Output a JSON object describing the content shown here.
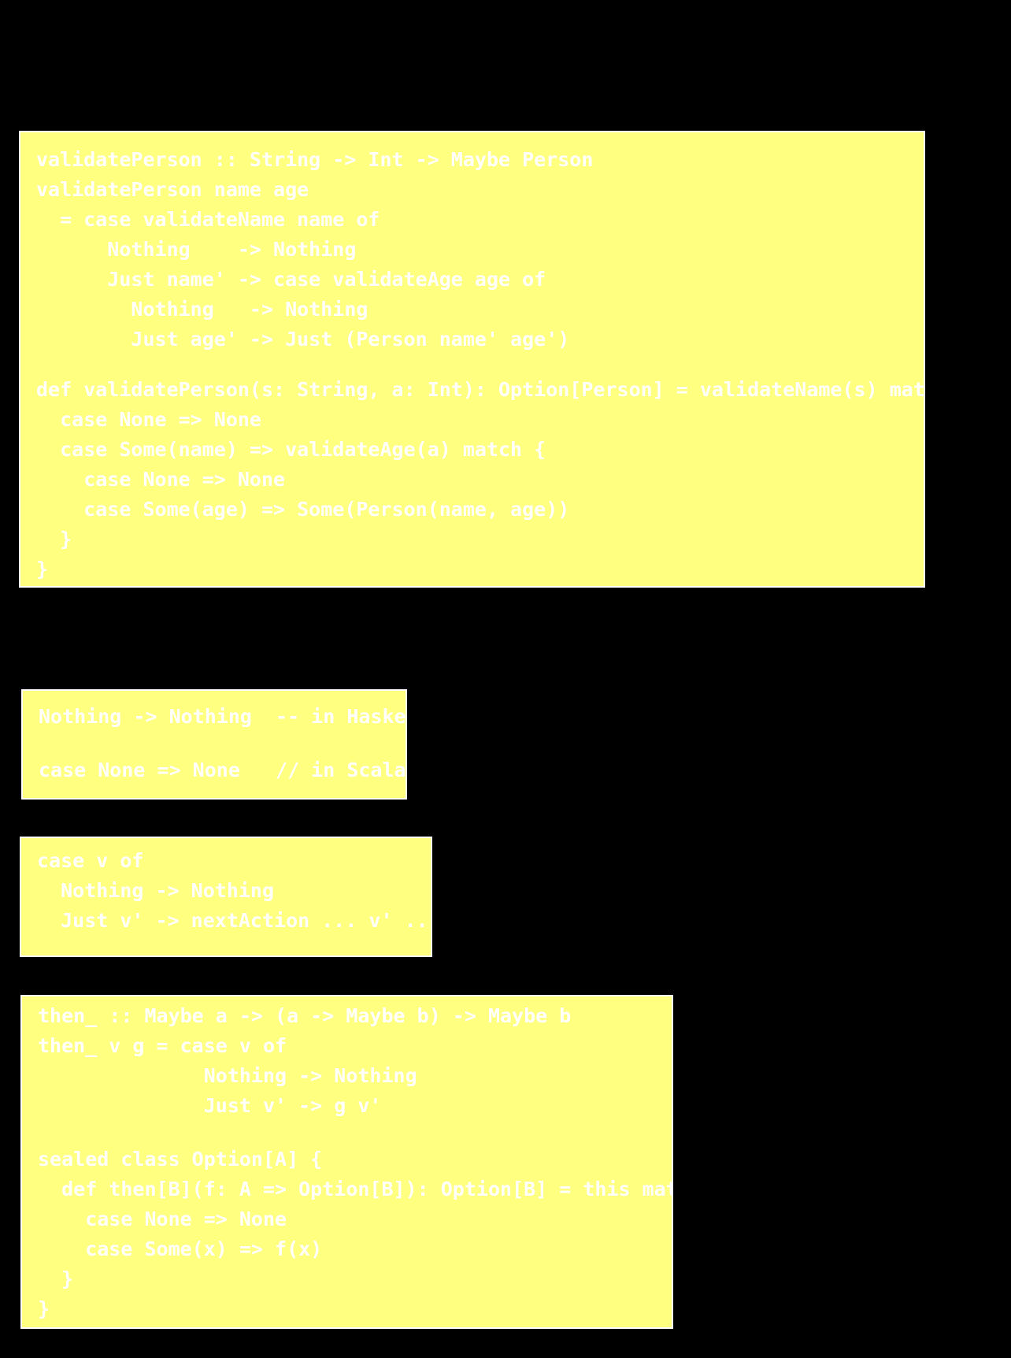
{
  "colors": {
    "background": "#000000",
    "code_box_fill": "#ffff80",
    "code_box_border": "#ffffff",
    "code_text": "#ffffff"
  },
  "blocks": {
    "validate": {
      "haskell": [
        "validatePerson :: String -> Int -> Maybe Person",
        "validatePerson name age",
        "  = case validateName name of",
        "      Nothing    -> Nothing",
        "      Just name' -> case validateAge age of",
        "        Nothing   -> Nothing",
        "        Just age' -> Just (Person name' age')"
      ],
      "scala": [
        "def validatePerson(s: String, a: Int): Option[Person] = validateName(s) match {",
        "  case None => None",
        "  case Some(name) => validateAge(a) match {",
        "    case None => None",
        "    case Some(age) => Some(Person(name, age))",
        "  }",
        "}"
      ]
    },
    "compare": {
      "haskell": "Nothing -> Nothing  -- in Haskell",
      "scala": "case None => None   // in Scala"
    },
    "pattern": [
      "case v of",
      "  Nothing -> Nothing",
      "  Just v' -> nextAction ... v' ..."
    ],
    "then": {
      "haskell": [
        "then_ :: Maybe a -> (a -> Maybe b) -> Maybe b",
        "then_ v g = case v of",
        "              Nothing -> Nothing",
        "              Just v' -> g v'"
      ],
      "scala": [
        "sealed class Option[A] {",
        "  def then[B](f: A => Option[B]): Option[B] = this match {",
        "    case None => None",
        "    case Some(x) => f(x)",
        "  }",
        "}"
      ]
    }
  }
}
